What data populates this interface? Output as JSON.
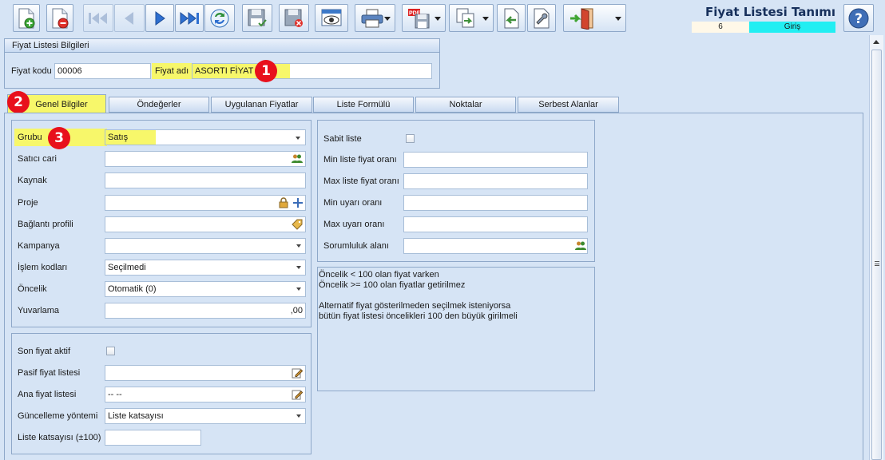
{
  "window": {
    "title": "Fiyat Listesi Tanımı",
    "record_number": "6",
    "mode": "Giriş"
  },
  "toolbar": {
    "buttons": [
      {
        "name": "new-record",
        "icon": "new-document-icon"
      },
      {
        "name": "delete-record",
        "icon": "delete-document-icon"
      },
      {
        "name": "first-record",
        "icon": "skip-first-icon"
      },
      {
        "name": "previous-record",
        "icon": "previous-icon"
      },
      {
        "name": "next-record",
        "icon": "next-icon"
      },
      {
        "name": "last-record",
        "icon": "skip-last-icon"
      },
      {
        "name": "refresh",
        "icon": "refresh-icon"
      },
      {
        "name": "save",
        "icon": "save-icon"
      },
      {
        "name": "save-close",
        "icon": "save-close-icon"
      },
      {
        "name": "preview",
        "icon": "eye-icon"
      },
      {
        "name": "print",
        "icon": "printer-icon"
      },
      {
        "name": "export-pdf",
        "icon": "pdf-save-icon",
        "label": "PDF"
      },
      {
        "name": "copy",
        "icon": "copy-icon"
      },
      {
        "name": "import",
        "icon": "import-icon"
      },
      {
        "name": "properties",
        "icon": "wrench-icon"
      },
      {
        "name": "exit",
        "icon": "exit-door-icon"
      }
    ],
    "help_icon": "help-icon"
  },
  "info_group": {
    "title": "Fiyat Listesi Bilgileri",
    "code_label": "Fiyat kodu",
    "code_value": "00006",
    "name_label": "Fiyat adı",
    "name_value": "ASORTI FİYAT"
  },
  "annotations": [
    "1",
    "2",
    "3"
  ],
  "tabs": [
    {
      "label": "Genel Bilgiler",
      "active": true
    },
    {
      "label": "Öndeğerler",
      "active": false
    },
    {
      "label": "Uygulanan Fiyatlar",
      "active": false
    },
    {
      "label": "Liste Formülü",
      "active": false
    },
    {
      "label": "Noktalar",
      "active": false
    },
    {
      "label": "Serbest Alanlar",
      "active": false
    }
  ],
  "general": {
    "grubu": {
      "label": "Grubu",
      "value": "Satış"
    },
    "satici_cari": {
      "label": "Satıcı cari",
      "value": ""
    },
    "kaynak": {
      "label": "Kaynak",
      "value": ""
    },
    "proje": {
      "label": "Proje",
      "value": ""
    },
    "baglanti_profili": {
      "label": "Bağlantı profili",
      "value": ""
    },
    "kampanya": {
      "label": "Kampanya",
      "value": ""
    },
    "islem_kodlari": {
      "label": "İşlem kodları",
      "value": "Seçilmedi"
    },
    "oncelik": {
      "label": "Öncelik",
      "value": "Otomatik (0)"
    },
    "yuvarlama": {
      "label": "Yuvarlama",
      "value": ",00"
    }
  },
  "last_price": {
    "son_fiyat_aktif": {
      "label": "Son fiyat aktif",
      "checked": false
    },
    "pasif_fiyat_listesi": {
      "label": "Pasif fiyat listesi",
      "value": ""
    },
    "ana_fiyat_listesi": {
      "label": "Ana fiyat listesi",
      "value": "-- --"
    },
    "guncelleme_yontemi": {
      "label": "Güncelleme yöntemi",
      "value": "Liste katsayısı"
    },
    "liste_katsayisi": {
      "label": "Liste katsayısı (±100)",
      "value": ""
    }
  },
  "limits": {
    "sabit_liste": {
      "label": "Sabit liste",
      "checked": false
    },
    "min_liste": {
      "label": "Min liste fiyat oranı",
      "value": ""
    },
    "max_liste": {
      "label": "Max liste fiyat oranı",
      "value": ""
    },
    "min_uyari": {
      "label": "Min uyarı oranı",
      "value": ""
    },
    "max_uyari": {
      "label": "Max uyarı oranı",
      "value": ""
    },
    "sorumluluk": {
      "label": "Sorumluluk alanı",
      "value": ""
    }
  },
  "note": {
    "line1": "Öncelik < 100 olan fiyat varken",
    "line2": "Öncelik >= 100 olan fiyatlar getirilmez",
    "line3": "Alternatif fiyat gösterilmeden seçilmek isteniyorsa",
    "line4": "bütün fiyat listesi öncelikleri 100 den büyük girilmeli"
  },
  "colors": {
    "highlight": "#f7f76a",
    "badge": "#e8101c",
    "mode_bg": "#22eef2",
    "panel_bg": "#d6e4f5"
  }
}
